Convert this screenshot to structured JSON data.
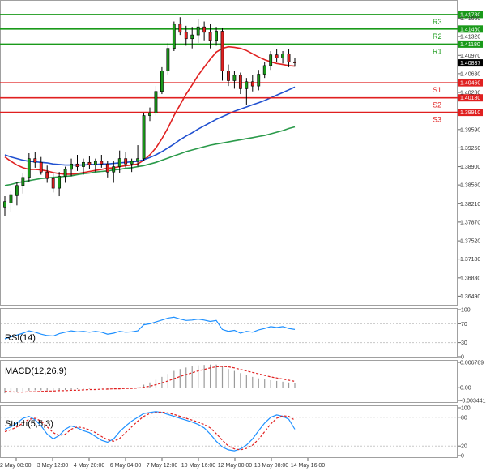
{
  "chart_data": [
    {
      "type": "candlestick",
      "panel": "price",
      "title": "",
      "yticks": [
        1.3649,
        1.3683,
        1.3718,
        1.3752,
        1.3787,
        1.3821,
        1.3856,
        1.389,
        1.3925,
        1.3959,
        1.4028,
        1.4063,
        1.4097,
        1.4132,
        1.4166
      ],
      "yticks_display": [
        "1.36490",
        "1.36830",
        "1.37180",
        "1.37520",
        "1.37870",
        "1.38210",
        "1.38560",
        "1.38900",
        "1.39250",
        "1.39590",
        "1.40280",
        "1.40630",
        "1.40970",
        "1.41320",
        "1.41660"
      ],
      "ylim": [
        1.3633,
        1.4197
      ],
      "xticks": [
        "2 May 08:00",
        "3 May 12:00",
        "4 May 20:00",
        "6 May 04:00",
        "7 May 12:00",
        "10 May 16:00",
        "12 May 00:00",
        "13 May 08:00",
        "14 May 16:00"
      ],
      "levels": [
        {
          "name": "R3",
          "value": 1.4173,
          "label": "1.41730",
          "color": "#1a9a1a"
        },
        {
          "name": "R2",
          "value": 1.4146,
          "label": "1.41460",
          "color": "#1a9a1a"
        },
        {
          "name": "R1",
          "value": 1.4118,
          "label": "1.41180",
          "color": "#1a9a1a"
        },
        {
          "name": "S1",
          "value": 1.4046,
          "label": "1.40460",
          "color": "#e02020"
        },
        {
          "name": "S2",
          "value": 1.4018,
          "label": "1.40180",
          "color": "#e02020"
        },
        {
          "name": "S3",
          "value": 1.3991,
          "label": "1.39910",
          "color": "#e02020"
        }
      ],
      "current_price": {
        "value": 1.4083,
        "label": "1.40837"
      },
      "candles": [
        {
          "o": 1.3815,
          "h": 1.3835,
          "l": 1.3798,
          "c": 1.3825
        },
        {
          "o": 1.3822,
          "h": 1.3845,
          "l": 1.3805,
          "c": 1.3838
        },
        {
          "o": 1.3836,
          "h": 1.3862,
          "l": 1.3818,
          "c": 1.3855
        },
        {
          "o": 1.3855,
          "h": 1.3878,
          "l": 1.384,
          "c": 1.387
        },
        {
          "o": 1.387,
          "h": 1.3915,
          "l": 1.3862,
          "c": 1.3905
        },
        {
          "o": 1.3905,
          "h": 1.3918,
          "l": 1.3888,
          "c": 1.3898
        },
        {
          "o": 1.3898,
          "h": 1.3908,
          "l": 1.3875,
          "c": 1.388
        },
        {
          "o": 1.388,
          "h": 1.3892,
          "l": 1.386,
          "c": 1.3868
        },
        {
          "o": 1.3868,
          "h": 1.3878,
          "l": 1.3842,
          "c": 1.385
        },
        {
          "o": 1.385,
          "h": 1.388,
          "l": 1.3835,
          "c": 1.3872
        },
        {
          "o": 1.3872,
          "h": 1.389,
          "l": 1.386,
          "c": 1.3885
        },
        {
          "o": 1.3885,
          "h": 1.3905,
          "l": 1.3872,
          "c": 1.3895
        },
        {
          "o": 1.3895,
          "h": 1.3912,
          "l": 1.3882,
          "c": 1.389
        },
        {
          "o": 1.389,
          "h": 1.3905,
          "l": 1.3875,
          "c": 1.3898
        },
        {
          "o": 1.3898,
          "h": 1.391,
          "l": 1.3885,
          "c": 1.3893
        },
        {
          "o": 1.3893,
          "h": 1.3905,
          "l": 1.388,
          "c": 1.39
        },
        {
          "o": 1.39,
          "h": 1.3912,
          "l": 1.3888,
          "c": 1.3895
        },
        {
          "o": 1.3895,
          "h": 1.39,
          "l": 1.387,
          "c": 1.388
        },
        {
          "o": 1.388,
          "h": 1.39,
          "l": 1.386,
          "c": 1.389
        },
        {
          "o": 1.389,
          "h": 1.392,
          "l": 1.3878,
          "c": 1.3905
        },
        {
          "o": 1.3905,
          "h": 1.3918,
          "l": 1.3888,
          "c": 1.3895
        },
        {
          "o": 1.3895,
          "h": 1.3905,
          "l": 1.388,
          "c": 1.39
        },
        {
          "o": 1.39,
          "h": 1.393,
          "l": 1.389,
          "c": 1.3905
        },
        {
          "o": 1.3905,
          "h": 1.399,
          "l": 1.39,
          "c": 1.3985
        },
        {
          "o": 1.3985,
          "h": 1.4,
          "l": 1.3975,
          "c": 1.399
        },
        {
          "o": 1.399,
          "h": 1.404,
          "l": 1.3985,
          "c": 1.403
        },
        {
          "o": 1.403,
          "h": 1.4075,
          "l": 1.4025,
          "c": 1.4068
        },
        {
          "o": 1.4068,
          "h": 1.412,
          "l": 1.406,
          "c": 1.411
        },
        {
          "o": 1.411,
          "h": 1.416,
          "l": 1.4105,
          "c": 1.4155
        },
        {
          "o": 1.4155,
          "h": 1.4168,
          "l": 1.4135,
          "c": 1.414
        },
        {
          "o": 1.414,
          "h": 1.4152,
          "l": 1.4115,
          "c": 1.4128
        },
        {
          "o": 1.4128,
          "h": 1.415,
          "l": 1.411,
          "c": 1.4135
        },
        {
          "o": 1.4135,
          "h": 1.4165,
          "l": 1.412,
          "c": 1.415
        },
        {
          "o": 1.415,
          "h": 1.416,
          "l": 1.4125,
          "c": 1.414
        },
        {
          "o": 1.414,
          "h": 1.4155,
          "l": 1.411,
          "c": 1.4125
        },
        {
          "o": 1.4125,
          "h": 1.415,
          "l": 1.4115,
          "c": 1.4142
        },
        {
          "o": 1.4142,
          "h": 1.4148,
          "l": 1.405,
          "c": 1.4068
        },
        {
          "o": 1.4068,
          "h": 1.408,
          "l": 1.404,
          "c": 1.405
        },
        {
          "o": 1.405,
          "h": 1.4068,
          "l": 1.4035,
          "c": 1.406
        },
        {
          "o": 1.406,
          "h": 1.4065,
          "l": 1.4025,
          "c": 1.4035
        },
        {
          "o": 1.4035,
          "h": 1.4055,
          "l": 1.4005,
          "c": 1.4048
        },
        {
          "o": 1.4048,
          "h": 1.406,
          "l": 1.403,
          "c": 1.404
        },
        {
          "o": 1.404,
          "h": 1.407,
          "l": 1.4032,
          "c": 1.4062
        },
        {
          "o": 1.4062,
          "h": 1.4085,
          "l": 1.4055,
          "c": 1.4078
        },
        {
          "o": 1.4078,
          "h": 1.4105,
          "l": 1.407,
          "c": 1.4098
        },
        {
          "o": 1.4098,
          "h": 1.4108,
          "l": 1.4085,
          "c": 1.4092
        },
        {
          "o": 1.4092,
          "h": 1.4105,
          "l": 1.4082,
          "c": 1.41
        },
        {
          "o": 1.41,
          "h": 1.4108,
          "l": 1.4075,
          "c": 1.4085
        },
        {
          "o": 1.4085,
          "h": 1.4092,
          "l": 1.4076,
          "c": 1.4083
        }
      ],
      "moving_averages": [
        {
          "color": "#e02020",
          "values": [
            1.3908,
            1.39,
            1.3893,
            1.3888,
            1.3885,
            1.3885,
            1.3884,
            1.3882,
            1.3879,
            1.3877,
            1.3876,
            1.3876,
            1.3877,
            1.3879,
            1.3881,
            1.3883,
            1.3885,
            1.3887,
            1.3888,
            1.389,
            1.3892,
            1.3893,
            1.3895,
            1.3902,
            1.3912,
            1.3925,
            1.3942,
            1.3962,
            1.3985,
            1.4005,
            1.4025,
            1.4042,
            1.406,
            1.4075,
            1.409,
            1.4103,
            1.411,
            1.4113,
            1.4112,
            1.411,
            1.4106,
            1.41,
            1.4094,
            1.4089,
            1.4085,
            1.4082,
            1.408,
            1.4078,
            1.4077
          ]
        },
        {
          "color": "#2050d0",
          "values": [
            1.3912,
            1.3908,
            1.3905,
            1.3902,
            1.39,
            1.3899,
            1.3898,
            1.3897,
            1.3895,
            1.3894,
            1.3893,
            1.3893,
            1.3893,
            1.3893,
            1.3894,
            1.3894,
            1.3895,
            1.3895,
            1.3896,
            1.3897,
            1.3898,
            1.3899,
            1.39,
            1.3903,
            1.3907,
            1.3912,
            1.3918,
            1.3925,
            1.3932,
            1.394,
            1.3947,
            1.3953,
            1.396,
            1.3966,
            1.3972,
            1.3978,
            1.3983,
            1.3988,
            1.3993,
            1.3997,
            1.4001,
            1.4005,
            1.4009,
            1.4013,
            1.4018,
            1.4023,
            1.4028,
            1.4033,
            1.4038
          ]
        },
        {
          "color": "#2a9a4a",
          "values": [
            1.3855,
            1.3857,
            1.386,
            1.3862,
            1.3864,
            1.3866,
            1.3868,
            1.3869,
            1.387,
            1.3871,
            1.3872,
            1.3873,
            1.3875,
            1.3877,
            1.3878,
            1.388,
            1.3881,
            1.3882,
            1.3884,
            1.3885,
            1.3887,
            1.3888,
            1.389,
            1.3892,
            1.3895,
            1.3898,
            1.3902,
            1.3906,
            1.391,
            1.3914,
            1.3918,
            1.3921,
            1.3924,
            1.3927,
            1.393,
            1.3932,
            1.3934,
            1.3936,
            1.3938,
            1.394,
            1.3942,
            1.3944,
            1.3946,
            1.3948,
            1.3951,
            1.3954,
            1.3957,
            1.3961,
            1.3964
          ]
        }
      ]
    },
    {
      "type": "line",
      "panel": "rsi",
      "label": "RSI(14)",
      "yticks": [
        100,
        70,
        30,
        0
      ],
      "ylim": [
        0,
        100
      ],
      "series": [
        {
          "color": "#1e90ff",
          "values": [
            38,
            42,
            46,
            50,
            55,
            52,
            48,
            45,
            44,
            49,
            52,
            55,
            53,
            54,
            52,
            54,
            52,
            48,
            50,
            54,
            52,
            53,
            55,
            68,
            70,
            74,
            78,
            82,
            84,
            80,
            77,
            78,
            80,
            78,
            75,
            77,
            58,
            54,
            56,
            50,
            54,
            52,
            57,
            60,
            64,
            62,
            64,
            60,
            58
          ]
        }
      ]
    },
    {
      "type": "bar",
      "panel": "macd",
      "label": "MACD(12,26,9)",
      "yticks": [
        0.006789,
        0.0,
        -0.003441
      ],
      "yticks_display": [
        "0.006789",
        "0.00",
        "-0.003441"
      ],
      "ylim": [
        -0.003441,
        0.006789
      ],
      "histogram": [
        -0.0015,
        -0.0014,
        -0.0012,
        -0.001,
        -0.0008,
        -0.0007,
        -0.0007,
        -0.0007,
        -0.0008,
        -0.0007,
        -0.0006,
        -0.0005,
        -0.0004,
        -0.0003,
        -0.0003,
        -0.0002,
        -0.0002,
        -0.0003,
        -0.0002,
        -0.0001,
        -0.0001,
        0.0,
        0.0001,
        0.0008,
        0.0014,
        0.0021,
        0.0029,
        0.0037,
        0.0045,
        0.005,
        0.0054,
        0.0057,
        0.006,
        0.0061,
        0.0062,
        0.0062,
        0.0056,
        0.005,
        0.0045,
        0.0039,
        0.0034,
        0.0029,
        0.0025,
        0.0022,
        0.002,
        0.0018,
        0.0016,
        0.0014,
        0.0012
      ],
      "signal": {
        "color": "#e02020",
        "values": [
          -0.001,
          -0.0011,
          -0.0012,
          -0.0012,
          -0.0011,
          -0.0011,
          -0.001,
          -0.0009,
          -0.0009,
          -0.0008,
          -0.0008,
          -0.0007,
          -0.0007,
          -0.0006,
          -0.0005,
          -0.0005,
          -0.0004,
          -0.0004,
          -0.0003,
          -0.0003,
          -0.0002,
          -0.0002,
          -0.0001,
          0.0001,
          0.0004,
          0.0008,
          0.0013,
          0.0018,
          0.0024,
          0.003,
          0.0035,
          0.004,
          0.0045,
          0.0049,
          0.0053,
          0.0056,
          0.0057,
          0.0056,
          0.0053,
          0.0049,
          0.0045,
          0.0041,
          0.0037,
          0.0033,
          0.0029,
          0.0026,
          0.0023,
          0.002,
          0.0017
        ]
      }
    },
    {
      "type": "line",
      "panel": "stochastic",
      "label": "Stoch(5,5,3)",
      "yticks": [
        100,
        80,
        20,
        0
      ],
      "ylim": [
        0,
        100
      ],
      "series": [
        {
          "color": "#1e90ff",
          "values": [
            55,
            60,
            68,
            78,
            82,
            75,
            62,
            45,
            35,
            42,
            55,
            62,
            58,
            52,
            48,
            40,
            32,
            28,
            35,
            50,
            62,
            72,
            80,
            88,
            90,
            92,
            90,
            86,
            82,
            78,
            74,
            70,
            65,
            58,
            45,
            30,
            18,
            12,
            10,
            14,
            22,
            35,
            52,
            68,
            80,
            85,
            82,
            76,
            55
          ]
        },
        {
          "color": "#e02020",
          "values": [
            50,
            54,
            60,
            68,
            76,
            78,
            72,
            60,
            48,
            42,
            45,
            55,
            60,
            58,
            54,
            48,
            40,
            33,
            30,
            36,
            48,
            60,
            72,
            82,
            88,
            90,
            91,
            89,
            86,
            82,
            78,
            74,
            70,
            65,
            58,
            46,
            32,
            20,
            14,
            12,
            15,
            22,
            34,
            50,
            66,
            78,
            83,
            82,
            74
          ]
        }
      ]
    }
  ],
  "colors": {
    "support": "#e02020",
    "resistance": "#1a9a1a",
    "bull_candle": "#1a9a1a",
    "bear_candle": "#e02020"
  }
}
